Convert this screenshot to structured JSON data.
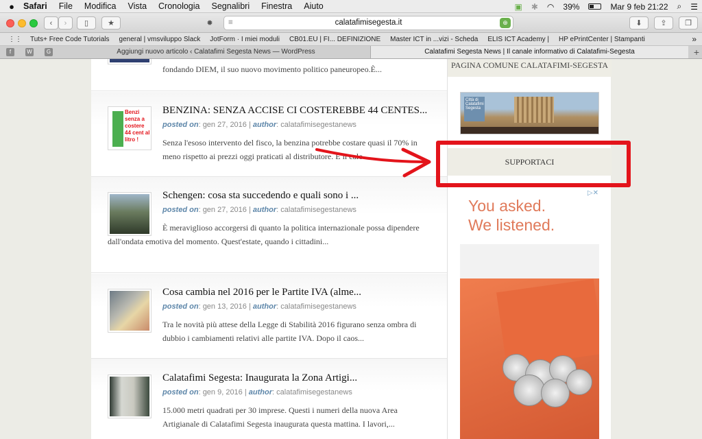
{
  "menubar": {
    "apple_icon": "apple-icon",
    "items": [
      "Safari",
      "File",
      "Modifica",
      "Vista",
      "Cronologia",
      "Segnalibri",
      "Finestra",
      "Aiuto"
    ],
    "battery": "39%",
    "datetime": "Mar 9 feb  21:22"
  },
  "toolbar": {
    "url": "calatafimisegesta.it"
  },
  "bookmarks": [
    "Tuts+ Free Code Tutorials",
    "general | vmsviluppo Slack",
    "JotForm · I miei moduli",
    "CB01.EU | FI... DEFINIZIONE",
    "Master ICT in ...vizi - Scheda",
    "ELIS ICT Academy |",
    "HP ePrintCenter | Stampanti"
  ],
  "tabs": {
    "pinned": [
      "f",
      "W",
      "G"
    ],
    "items": [
      "Aggiungi nuovo articolo ‹ Calatafimi Segesta News — WordPress",
      "Calatafimi Segesta News | Il canale informativo di Calatafimi-Segesta"
    ]
  },
  "posts": [
    {
      "title": "",
      "meta_date": "",
      "meta_author": "",
      "excerpt": "fondando DIEM, il suo nuovo movimento politico paneuropeo.È..."
    },
    {
      "title": "BENZINA: SENZA ACCISE CI COSTEREBBE 44 CENTES...",
      "posted_on_label": "posted on",
      "meta_date": "gen 27, 2016",
      "author_label": "author",
      "meta_author": "calatafimisegestanews",
      "excerpt": "Senza l'esoso intervento del fisco, la benzina potrebbe costare quasi il 70% in meno rispetto ai prezzi oggi praticati al distributore. E il calo...",
      "thumb_text": "Benzi senza a costere 44 cent al litro !"
    },
    {
      "title": "Schengen: cosa sta succedendo e quali sono i ...",
      "posted_on_label": "posted on",
      "meta_date": "gen 27, 2016",
      "author_label": "author",
      "meta_author": "calatafimisegestanews",
      "excerpt": "È meraviglioso accorgersi di quanto la politica internazionale possa dipendere dall'ondata emotiva del momento. Quest'estate, quando i cittadini..."
    },
    {
      "title": "Cosa cambia nel 2016 per le Partite IVA (alme...",
      "posted_on_label": "posted on",
      "meta_date": "gen 13, 2016",
      "author_label": "author",
      "meta_author": "calatafimisegestanews",
      "excerpt": "Tra le novità più attese della Legge di Stabilità 2016 figurano senza ombra di dubbio i cambiamenti relativi alle partite IVA. Dopo il caos..."
    },
    {
      "title": "Calatafimi Segesta: Inaugurata la Zona Artigi...",
      "posted_on_label": "posted on",
      "meta_date": "gen 9, 2016",
      "author_label": "author",
      "meta_author": "calatafimisegestanews",
      "excerpt": "15.000 metri quadrati per 30 imprese. Questi i numeri della nuova Area Artigianale di Calatafimi Segesta inaugurata questa mattina. I lavori,..."
    }
  ],
  "sidebar": {
    "widget_title": "PAGINA COMUNE CALATAFIMI-SEGESTA",
    "banner_caption": "Città di Calatafimi Segesta",
    "support_label": "SUPPORTACI",
    "ad_headline_1": "You asked.",
    "ad_headline_2": "We listened."
  },
  "colors": {
    "annotation_red": "#e3141b",
    "meta_blue": "#5d86a9",
    "ad_orange": "#e07a5a"
  }
}
